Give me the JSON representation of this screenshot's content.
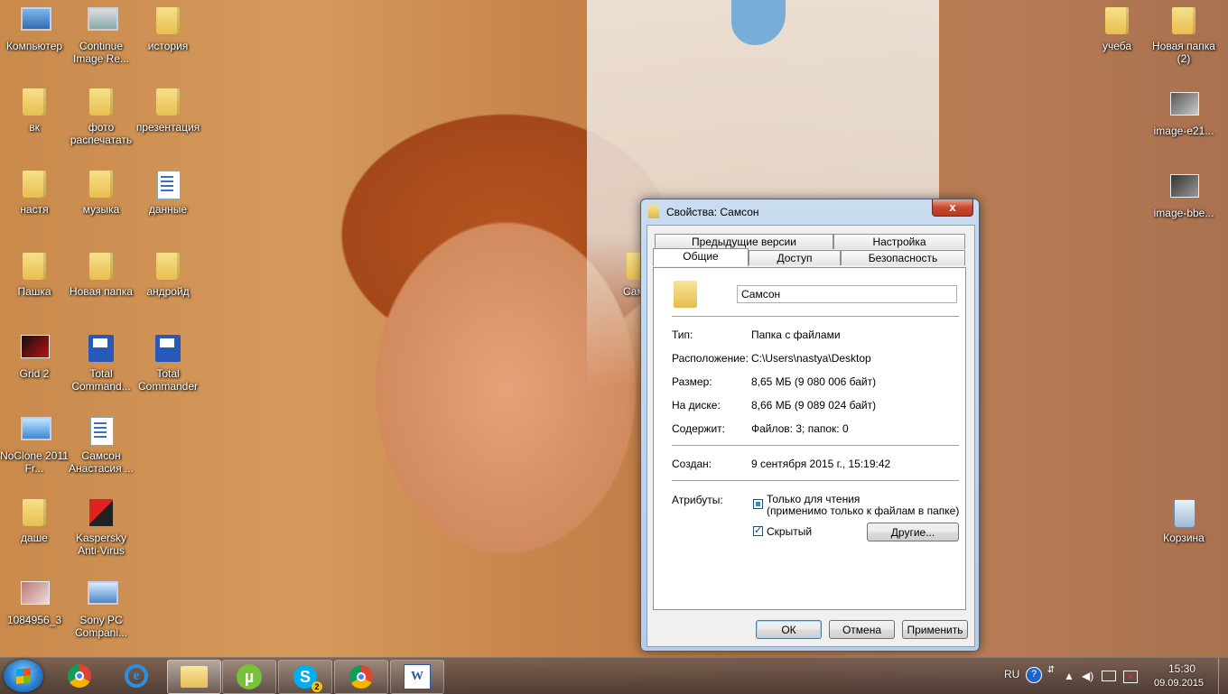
{
  "desktop": {
    "icons": [
      {
        "label": "Компьютер"
      },
      {
        "label": "Continue Image Re..."
      },
      {
        "label": "история"
      },
      {
        "label": "вк"
      },
      {
        "label": "фото распечатать"
      },
      {
        "label": "презентация"
      },
      {
        "label": "настя"
      },
      {
        "label": "музыка"
      },
      {
        "label": "данные"
      },
      {
        "label": "Пашка"
      },
      {
        "label": "Новая папка"
      },
      {
        "label": "андройд"
      },
      {
        "label": "Grid 2"
      },
      {
        "label": "Total Command..."
      },
      {
        "label": "Total Commander"
      },
      {
        "label": "NoClone 2011 Fr..."
      },
      {
        "label": "Самсон Анастасия ..."
      },
      {
        "label": "даше"
      },
      {
        "label": "Kaspersky Anti-Virus"
      },
      {
        "label": "1084956_3"
      },
      {
        "label": "Sony PC Compani..."
      },
      {
        "label": "учеба"
      },
      {
        "label": "Новая папка (2)"
      },
      {
        "label": "image-e21..."
      },
      {
        "label": "image-bbe..."
      },
      {
        "label": "Корзина"
      },
      {
        "label": "Сам"
      }
    ]
  },
  "dialog": {
    "title": "Свойства: Самсон",
    "close_label": "x",
    "tabs": {
      "prev_versions": "Предыдущие версии",
      "settings": "Настройка",
      "general": "Общие",
      "access": "Доступ",
      "security": "Безопасность"
    },
    "name_value": "Самсон",
    "rows": {
      "type_label": "Тип:",
      "type_value": "Папка с файлами",
      "location_label": "Расположение:",
      "location_value": "C:\\Users\\nastya\\Desktop",
      "size_label": "Размер:",
      "size_value": "8,65 МБ (9 080 006 байт)",
      "disk_label": "На диске:",
      "disk_value": "8,66 МБ (9 089 024 байт)",
      "contains_label": "Содержит:",
      "contains_value": "Файлов: 3; папок: 0",
      "created_label": "Создан:",
      "created_value": "9 сентября 2015 г., 15:19:42",
      "attributes_label": "Атрибуты:"
    },
    "attributes": {
      "readonly_label": "Только для чтения",
      "readonly_note": "(применимо только к файлам в папке)",
      "hidden_label": "Скрытый",
      "other_button": "Другие..."
    },
    "buttons": {
      "ok": "ОК",
      "cancel": "Отмена",
      "apply": "Применить"
    }
  },
  "taskbar": {
    "items": [
      "chrome-icon",
      "internet-explorer-icon",
      "explorer-folder-icon",
      "utorrent-icon",
      "skype-icon",
      "chrome-icon",
      "word-icon"
    ],
    "skype_badge": "2",
    "utorrent_glyph": "µ",
    "skype_glyph": "S",
    "word_glyph": "W",
    "ie_glyph": "e",
    "tray": {
      "language": "RU",
      "time": "15:30",
      "date": "09.09.2015"
    }
  }
}
